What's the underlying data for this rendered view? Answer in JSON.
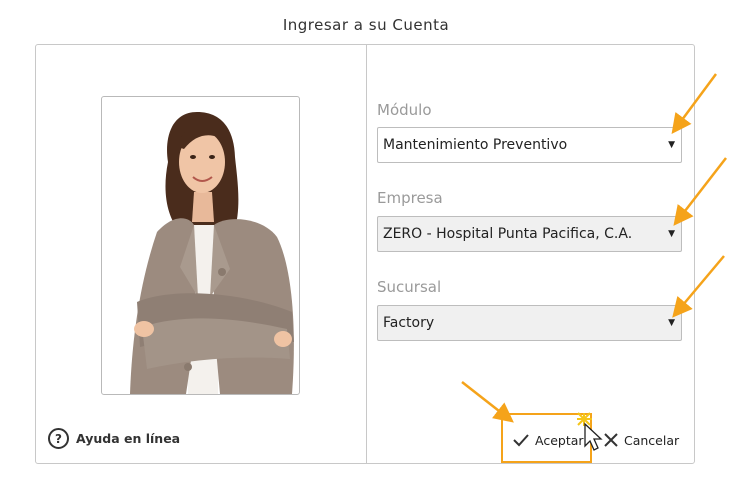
{
  "window": {
    "title": "Ingresar a su Cuenta"
  },
  "help": {
    "label": "Ayuda en línea",
    "icon": "question-circle-icon"
  },
  "fields": {
    "modulo": {
      "label": "Módulo",
      "value": "Mantenimiento Preventivo"
    },
    "empresa": {
      "label": "Empresa",
      "value": "ZERO - Hospital Punta Pacifica, C.A."
    },
    "sucursal": {
      "label": "Sucursal",
      "value": "Factory"
    }
  },
  "buttons": {
    "accept": {
      "label": "Aceptar",
      "icon": "checkmark-icon"
    },
    "cancel": {
      "label": "Cancelar",
      "icon": "close-icon"
    }
  },
  "annotation": {
    "color": "#f5a31a"
  }
}
